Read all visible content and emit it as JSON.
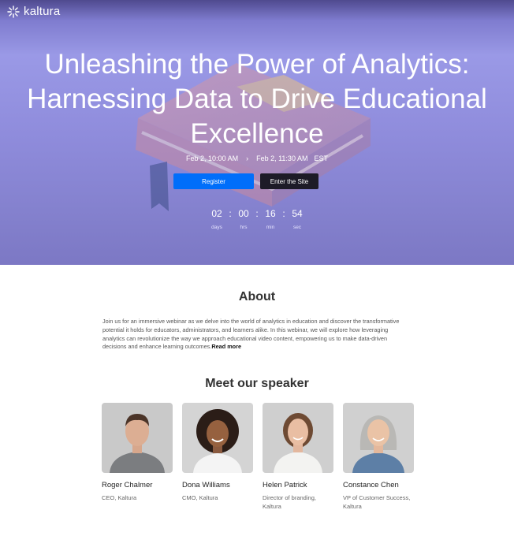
{
  "brand": {
    "name": "kaltura",
    "logo_icon": "kaltura-burst-icon"
  },
  "hero": {
    "title": "Unleashing the Power of Analytics: Harnessing Data to Drive Educational Excellence",
    "start": "Feb 2, 10:00 AM",
    "end": "Feb 2, 11:30 AM",
    "timezone": "EST",
    "arrow_icon": "chevron-right-icon",
    "register_label": "Register",
    "enter_label": "Enter the Site",
    "countdown": [
      {
        "value": "02",
        "label": "days"
      },
      {
        "value": "00",
        "label": "hrs"
      },
      {
        "value": "16",
        "label": "min"
      },
      {
        "value": "54",
        "label": "sec"
      }
    ]
  },
  "about": {
    "title": "About",
    "text": "Join us for an immersive webinar as we delve into the world of analytics in education and discover the transformative potential it holds for educators, administrators, and learners alike. In this webinar, we will explore how leveraging analytics can revolutionize the way we approach educational video content, empowering us to make data-driven decisions and enhance learning outcomes.",
    "read_more": "Read more"
  },
  "speakers": {
    "title": "Meet our speaker",
    "items": [
      {
        "name": "Roger Chalmer",
        "role": "CEO, Kaltura"
      },
      {
        "name": "Dona Williams",
        "role": "CMO, Kaltura"
      },
      {
        "name": "Helen Patrick",
        "role": "Director of branding, Kaltura"
      },
      {
        "name": "Constance Chen",
        "role": "VP of Customer Success, Kaltura"
      }
    ]
  },
  "colors": {
    "primary": "#006efa",
    "dark_button": "#1d1b27",
    "hero_purple": "#8f8cdc"
  }
}
